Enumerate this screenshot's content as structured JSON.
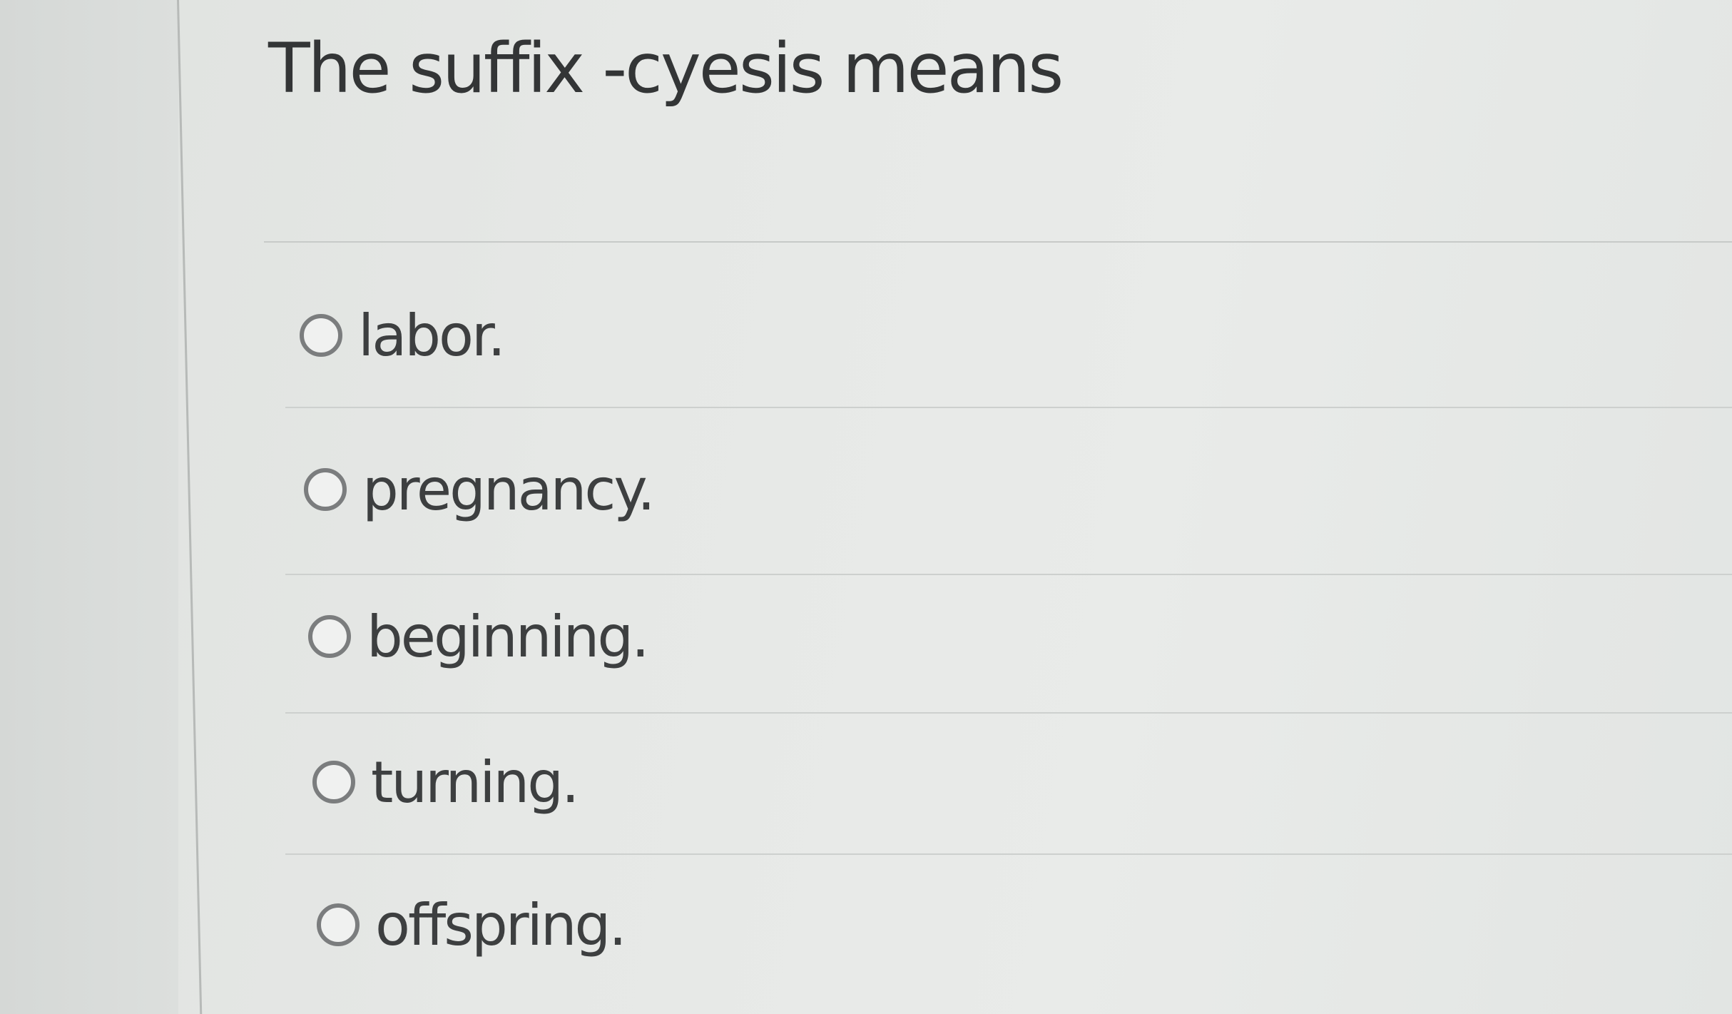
{
  "question": {
    "text": "The suffix -cyesis means"
  },
  "answers": [
    {
      "label": "labor.",
      "selected": false
    },
    {
      "label": "pregnancy.",
      "selected": false
    },
    {
      "label": "beginning.",
      "selected": false
    },
    {
      "label": "turning.",
      "selected": false
    },
    {
      "label": "offspring.",
      "selected": false
    }
  ]
}
